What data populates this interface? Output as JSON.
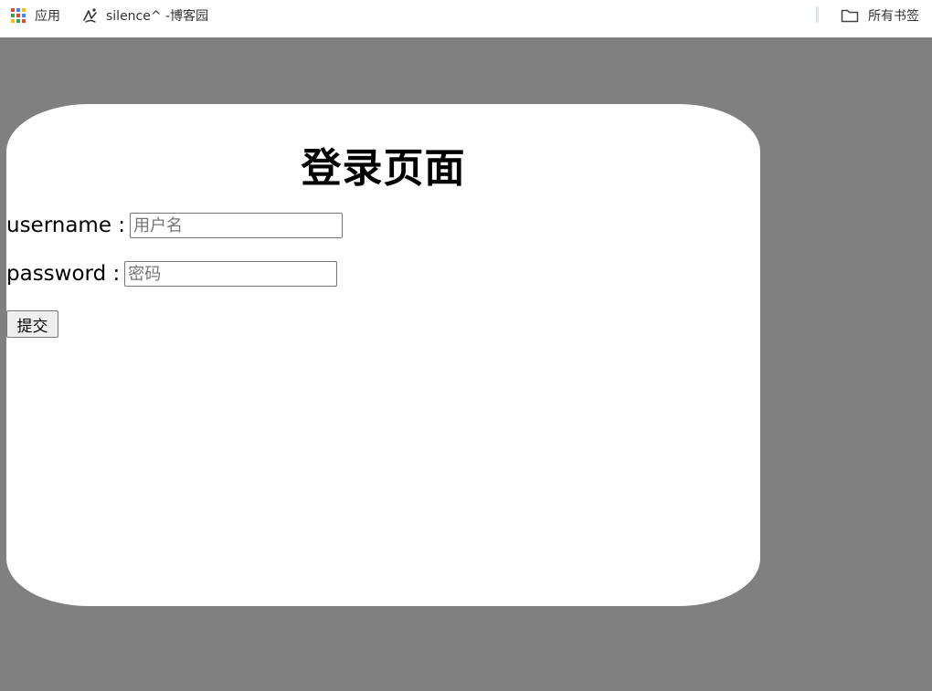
{
  "bookmarks": {
    "apps_label": "应用",
    "blog_label": "silence^ -博客园",
    "all_label": "所有书签",
    "apps_icon": "apps-grid-icon",
    "blog_icon": "cnblogs-icon",
    "all_icon": "folder-icon",
    "apps_colors": [
      "#ea4335",
      "#4285f4",
      "#fbbc05",
      "#34a853",
      "#ea4335",
      "#4285f4",
      "#fbbc05",
      "#34a853",
      "#ea4335"
    ]
  },
  "page": {
    "background": "#808080",
    "title": "登录页面",
    "username_label": "username :",
    "username_placeholder": "用户名",
    "username_value": "",
    "password_label": "password :",
    "password_placeholder": "密码",
    "password_value": "",
    "submit_label": "提交"
  }
}
